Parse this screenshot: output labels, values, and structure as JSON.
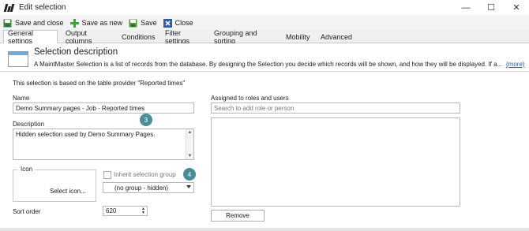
{
  "window": {
    "title": "Edit selection",
    "minimize_glyph": "—",
    "maximize_glyph": "☐",
    "close_glyph": "✕"
  },
  "toolbar": {
    "save_and_close": "Save and close",
    "save_as_new": "Save as new",
    "save": "Save",
    "close": "Close"
  },
  "tabs": [
    {
      "label": "General settings",
      "active": true
    },
    {
      "label": "Output columns"
    },
    {
      "label": "Conditions"
    },
    {
      "label": "Filter settings"
    },
    {
      "label": "Grouping and sorting"
    },
    {
      "label": "Mobility"
    },
    {
      "label": "Advanced"
    }
  ],
  "header": {
    "title": "Selection description",
    "text": "A MaintMaster Selection is a list of records from the database. By designing the Selection you decide which records will be shown, and how they will be displayed. If a...",
    "more_link": "(more)"
  },
  "form": {
    "provider_text": "This selection is based on the table provider \"Reported times\"",
    "name_label": "Name",
    "name_value": "Demo Summary pages - Job - Reported times",
    "description_label": "Description",
    "description_value": "Hidden selection used by Demo Summary Pages.",
    "icon_label": "Icon",
    "select_icon_label": "Select icon...",
    "inherit_group_label": "Inherit selection group",
    "inherit_group_checked": false,
    "group_value": "(no group - hidden)",
    "sort_order_label": "Sort order",
    "sort_order_value": "620"
  },
  "roles": {
    "label": "Assigned to roles and users",
    "search_placeholder": "Search to add role or person",
    "remove_label": "Remove"
  },
  "badges": [
    "3",
    "4"
  ],
  "colors": {
    "badge": "#4a8f97",
    "link": "#1a5fb4"
  }
}
